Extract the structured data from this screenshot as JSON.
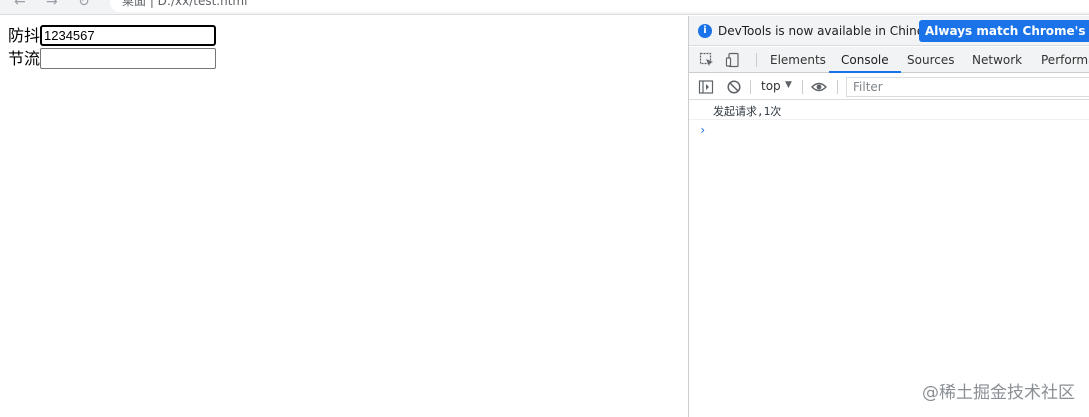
{
  "browser": {
    "address_text": "桌面 | D:/xx/test.html"
  },
  "page": {
    "debounce": {
      "label": "防抖",
      "value": "1234567"
    },
    "throttle": {
      "label": "节流",
      "value": ""
    }
  },
  "devtools": {
    "info_text": "DevTools is now available in Chinese!",
    "info_button": "Always match Chrome's langua",
    "tabs": [
      "Elements",
      "Console",
      "Sources",
      "Network",
      "Performa"
    ],
    "active_tab": "Console",
    "context": "top",
    "filter_placeholder": "Filter",
    "logs": [
      "发起请求,1次"
    ],
    "prompt_symbol": "›"
  },
  "watermark": "@稀土掘金技术社区",
  "colors": {
    "accent": "#1a73e8"
  }
}
